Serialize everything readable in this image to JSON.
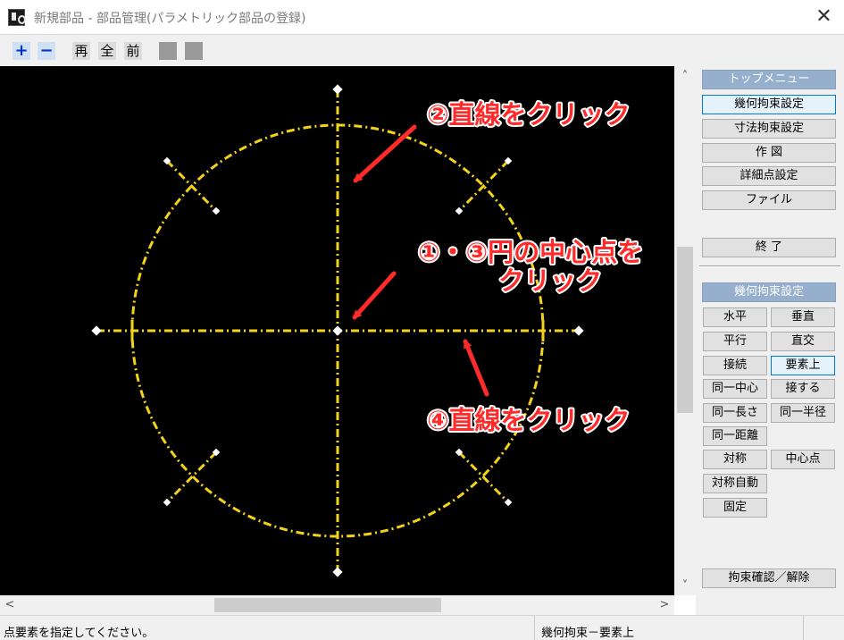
{
  "window": {
    "title": "新規部品 - 部品管理(パラメトリック部品の登録)",
    "close_glyph": "✕"
  },
  "toolbar": {
    "zoom_in": "+",
    "zoom_out": "−",
    "redraw": "再",
    "all": "全",
    "previous": "前"
  },
  "canvas": {
    "annotations": {
      "step2": "②直線をクリック",
      "step13_line1": "①・③円の中心点を",
      "step13_line2": "クリック",
      "step4": "④直線をクリック"
    },
    "colors": {
      "background": "#000000",
      "geometry": "#f2d21b",
      "annotation_text": "#ff2a2a",
      "annotation_outline": "#ffffff"
    }
  },
  "panel": {
    "top_menu": "トップメニュー",
    "geometric_constraint_settings": "幾何拘束設定",
    "dimension_constraint_settings": "寸法拘束設定",
    "drawing": "作 図",
    "detail_point_settings": "詳細点設定",
    "file": "ファイル",
    "exit": "終 了",
    "constraint_header": "幾何拘束設定",
    "constraints": {
      "horizontal": "水平",
      "vertical": "垂直",
      "parallel": "平行",
      "perpendicular": "直交",
      "connect": "接続",
      "on_element": "要素上",
      "concentric": "同一中心",
      "tangent": "接する",
      "equal_length": "同一長さ",
      "equal_radius": "同一半径",
      "equal_distance": "同一距離",
      "symmetric": "対称",
      "midpoint": "中心点",
      "auto_symmetric": "対称自動",
      "fixed": "固定"
    },
    "confirm_release": "拘束確認／解除"
  },
  "scrollbars": {
    "up": "˄",
    "down": "˅",
    "left": "<",
    "right": ">"
  },
  "status": {
    "message": "点要素を指定してください。",
    "mode": "幾何拘束－要素上"
  }
}
